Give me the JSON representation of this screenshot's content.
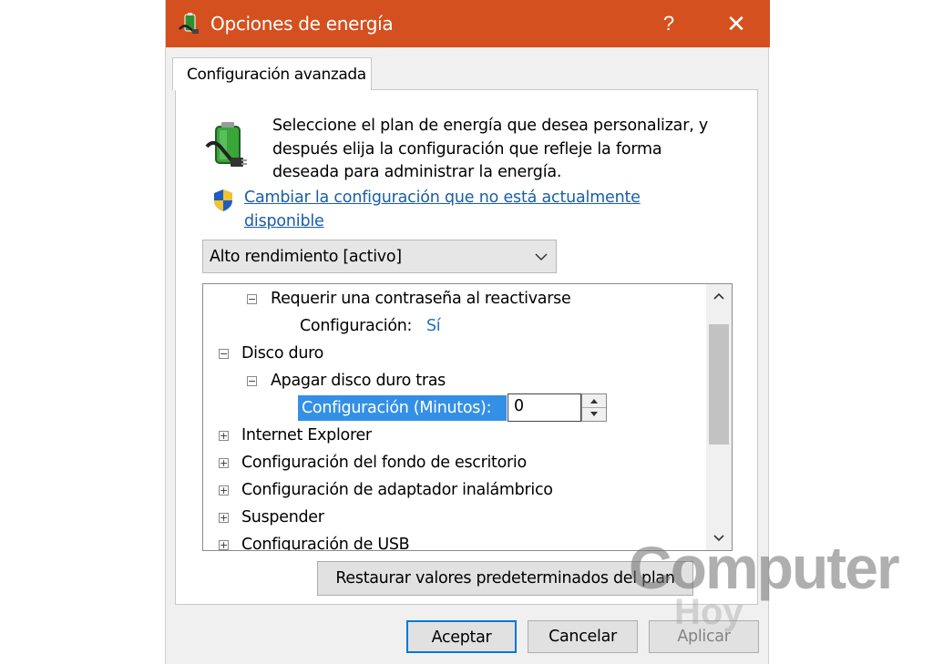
{
  "window": {
    "title": "Opciones de energía",
    "help_glyph": "?",
    "close_glyph": "✕",
    "titlebar_color": "#d4501f"
  },
  "tab": {
    "label": "Configuración avanzada"
  },
  "description": "Seleccione el plan de energía que desea personalizar, y después elija la configuración que refleje la forma deseada para administrar la energía.",
  "admin_link": "Cambiar la configuración que no está actualmente disponible",
  "plan_select": {
    "value": "Alto rendimiento [activo]"
  },
  "tree": {
    "items": [
      {
        "expander": "−",
        "label": "Requerir una contraseña al reactivarse"
      },
      {
        "label": "Configuración:",
        "value": "Sí"
      },
      {
        "expander": "−",
        "label": "Disco duro"
      },
      {
        "expander": "−",
        "label": "Apagar disco duro tras"
      },
      {
        "label": "Configuración (Minutos):",
        "value": "0"
      },
      {
        "expander": "+",
        "label": "Internet Explorer"
      },
      {
        "expander": "+",
        "label": "Configuración del fondo de escritorio"
      },
      {
        "expander": "+",
        "label": "Configuración de adaptador inalámbrico"
      },
      {
        "expander": "+",
        "label": "Suspender"
      },
      {
        "expander": "+",
        "label": "Configuración de USB"
      }
    ]
  },
  "buttons": {
    "restore": "Restaurar valores predeterminados del plan",
    "accept": "Aceptar",
    "cancel": "Cancelar",
    "apply": "Aplicar"
  },
  "watermark": {
    "brand": "Computer",
    "sub": "Hoy"
  },
  "colors": {
    "link": "#1a5ea8",
    "selection": "#3390e6",
    "accent": "#0078d7"
  }
}
